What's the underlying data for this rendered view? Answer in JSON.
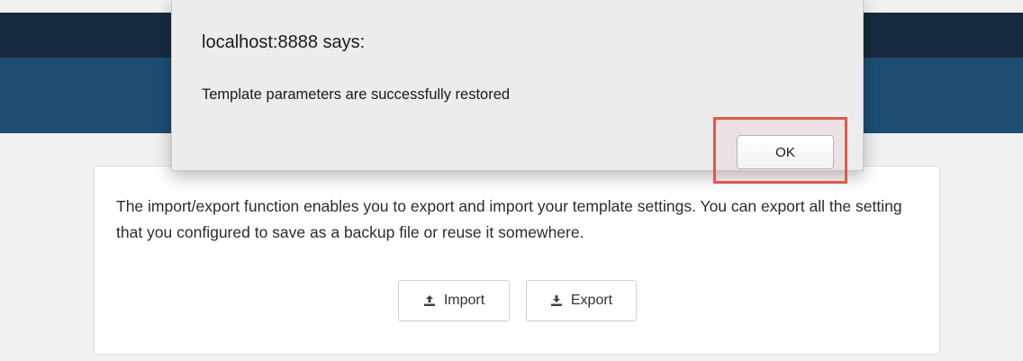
{
  "dialog": {
    "title": "localhost:8888 says:",
    "message": "Template parameters are successfully restored",
    "ok_label": "OK",
    "highlight_color": "#e0594e"
  },
  "panel": {
    "description": "The import/export function enables you to export and import your template settings. You can export all the setting that you configured to save as a backup file or reuse it somewhere.",
    "import_label": "Import",
    "export_label": "Export",
    "import_icon": "upload-icon",
    "export_icon": "download-icon"
  },
  "colors": {
    "topbar": "#172a3f",
    "header_band": "#1e4d74",
    "page_bg": "#f1f1f1"
  }
}
